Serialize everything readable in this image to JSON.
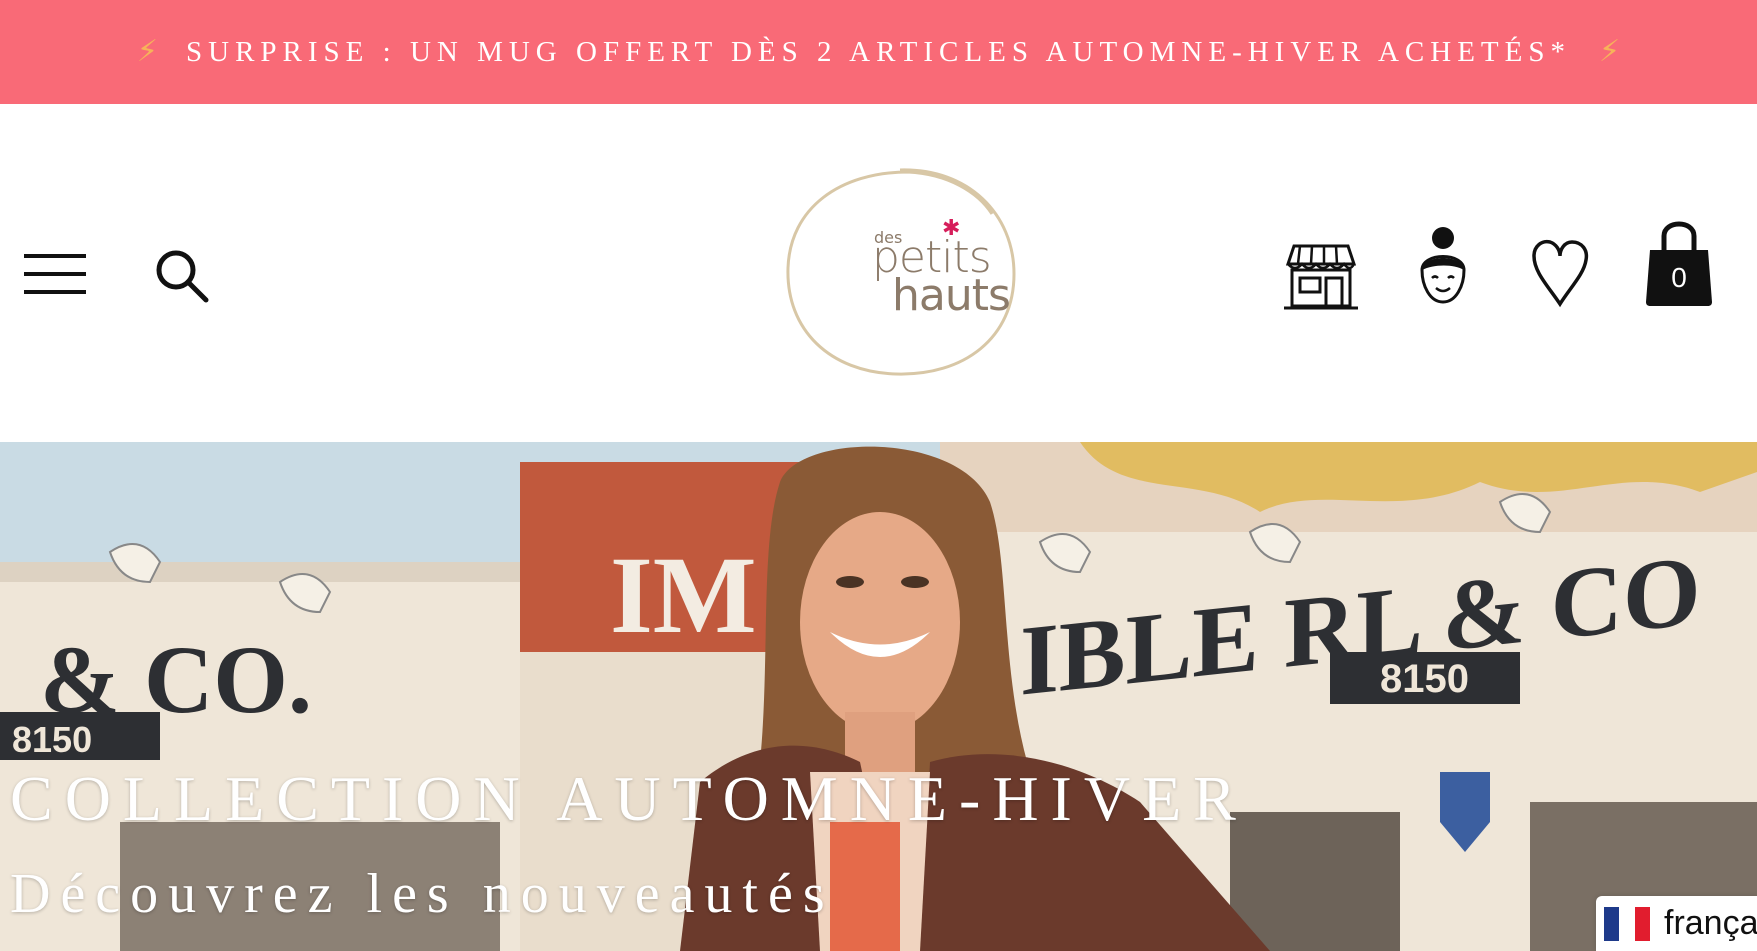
{
  "announcement": {
    "text": "Surprise : un mug offert dès 2 articles automne-hiver achetés*",
    "bolt_icon": "⚡",
    "bg_color": "#f96a77",
    "bolt_color": "#f7b35a"
  },
  "header": {
    "menu_icon": "hamburger-icon",
    "search_icon": "search-icon",
    "logo": {
      "small": "des",
      "line1": "petits",
      "line2": "hauts",
      "star_color": "#d61e5b"
    },
    "icons": [
      "store-icon",
      "account-icon",
      "heart-icon",
      "bag-icon"
    ],
    "cart_count": "0"
  },
  "hero": {
    "title": "Collection automne-hiver",
    "subtitle": "Découvrez les nouveautés"
  },
  "language": {
    "label": "français",
    "flag_colors": [
      "#1e3a8a",
      "#ffffff",
      "#e11d2e"
    ]
  }
}
